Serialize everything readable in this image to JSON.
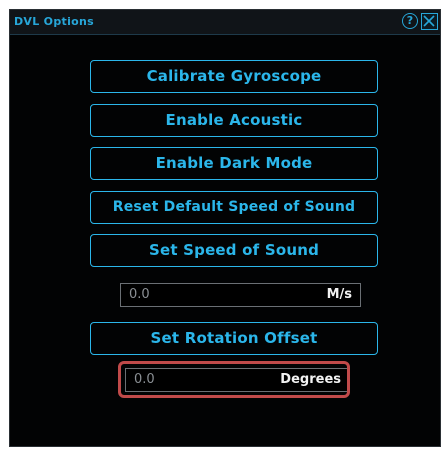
{
  "window": {
    "title": "DVL Options",
    "help_glyph": "?"
  },
  "buttons": {
    "calibrate": "Calibrate Gyroscope",
    "acoustic": "Enable Acoustic",
    "dark_mode": "Enable Dark Mode",
    "reset_sos": "Reset Default Speed of Sound",
    "set_sos": "Set Speed of Sound",
    "set_rotation": "Set Rotation Offset"
  },
  "speed_field": {
    "value": "0.0",
    "unit": "M/s"
  },
  "rotation_field": {
    "value": "0.0",
    "unit": "Degrees"
  },
  "colors": {
    "accent": "#2bb6ea",
    "background": "#020304",
    "highlight": "#c04a4a"
  },
  "icons": [
    "help-icon",
    "close-icon"
  ]
}
